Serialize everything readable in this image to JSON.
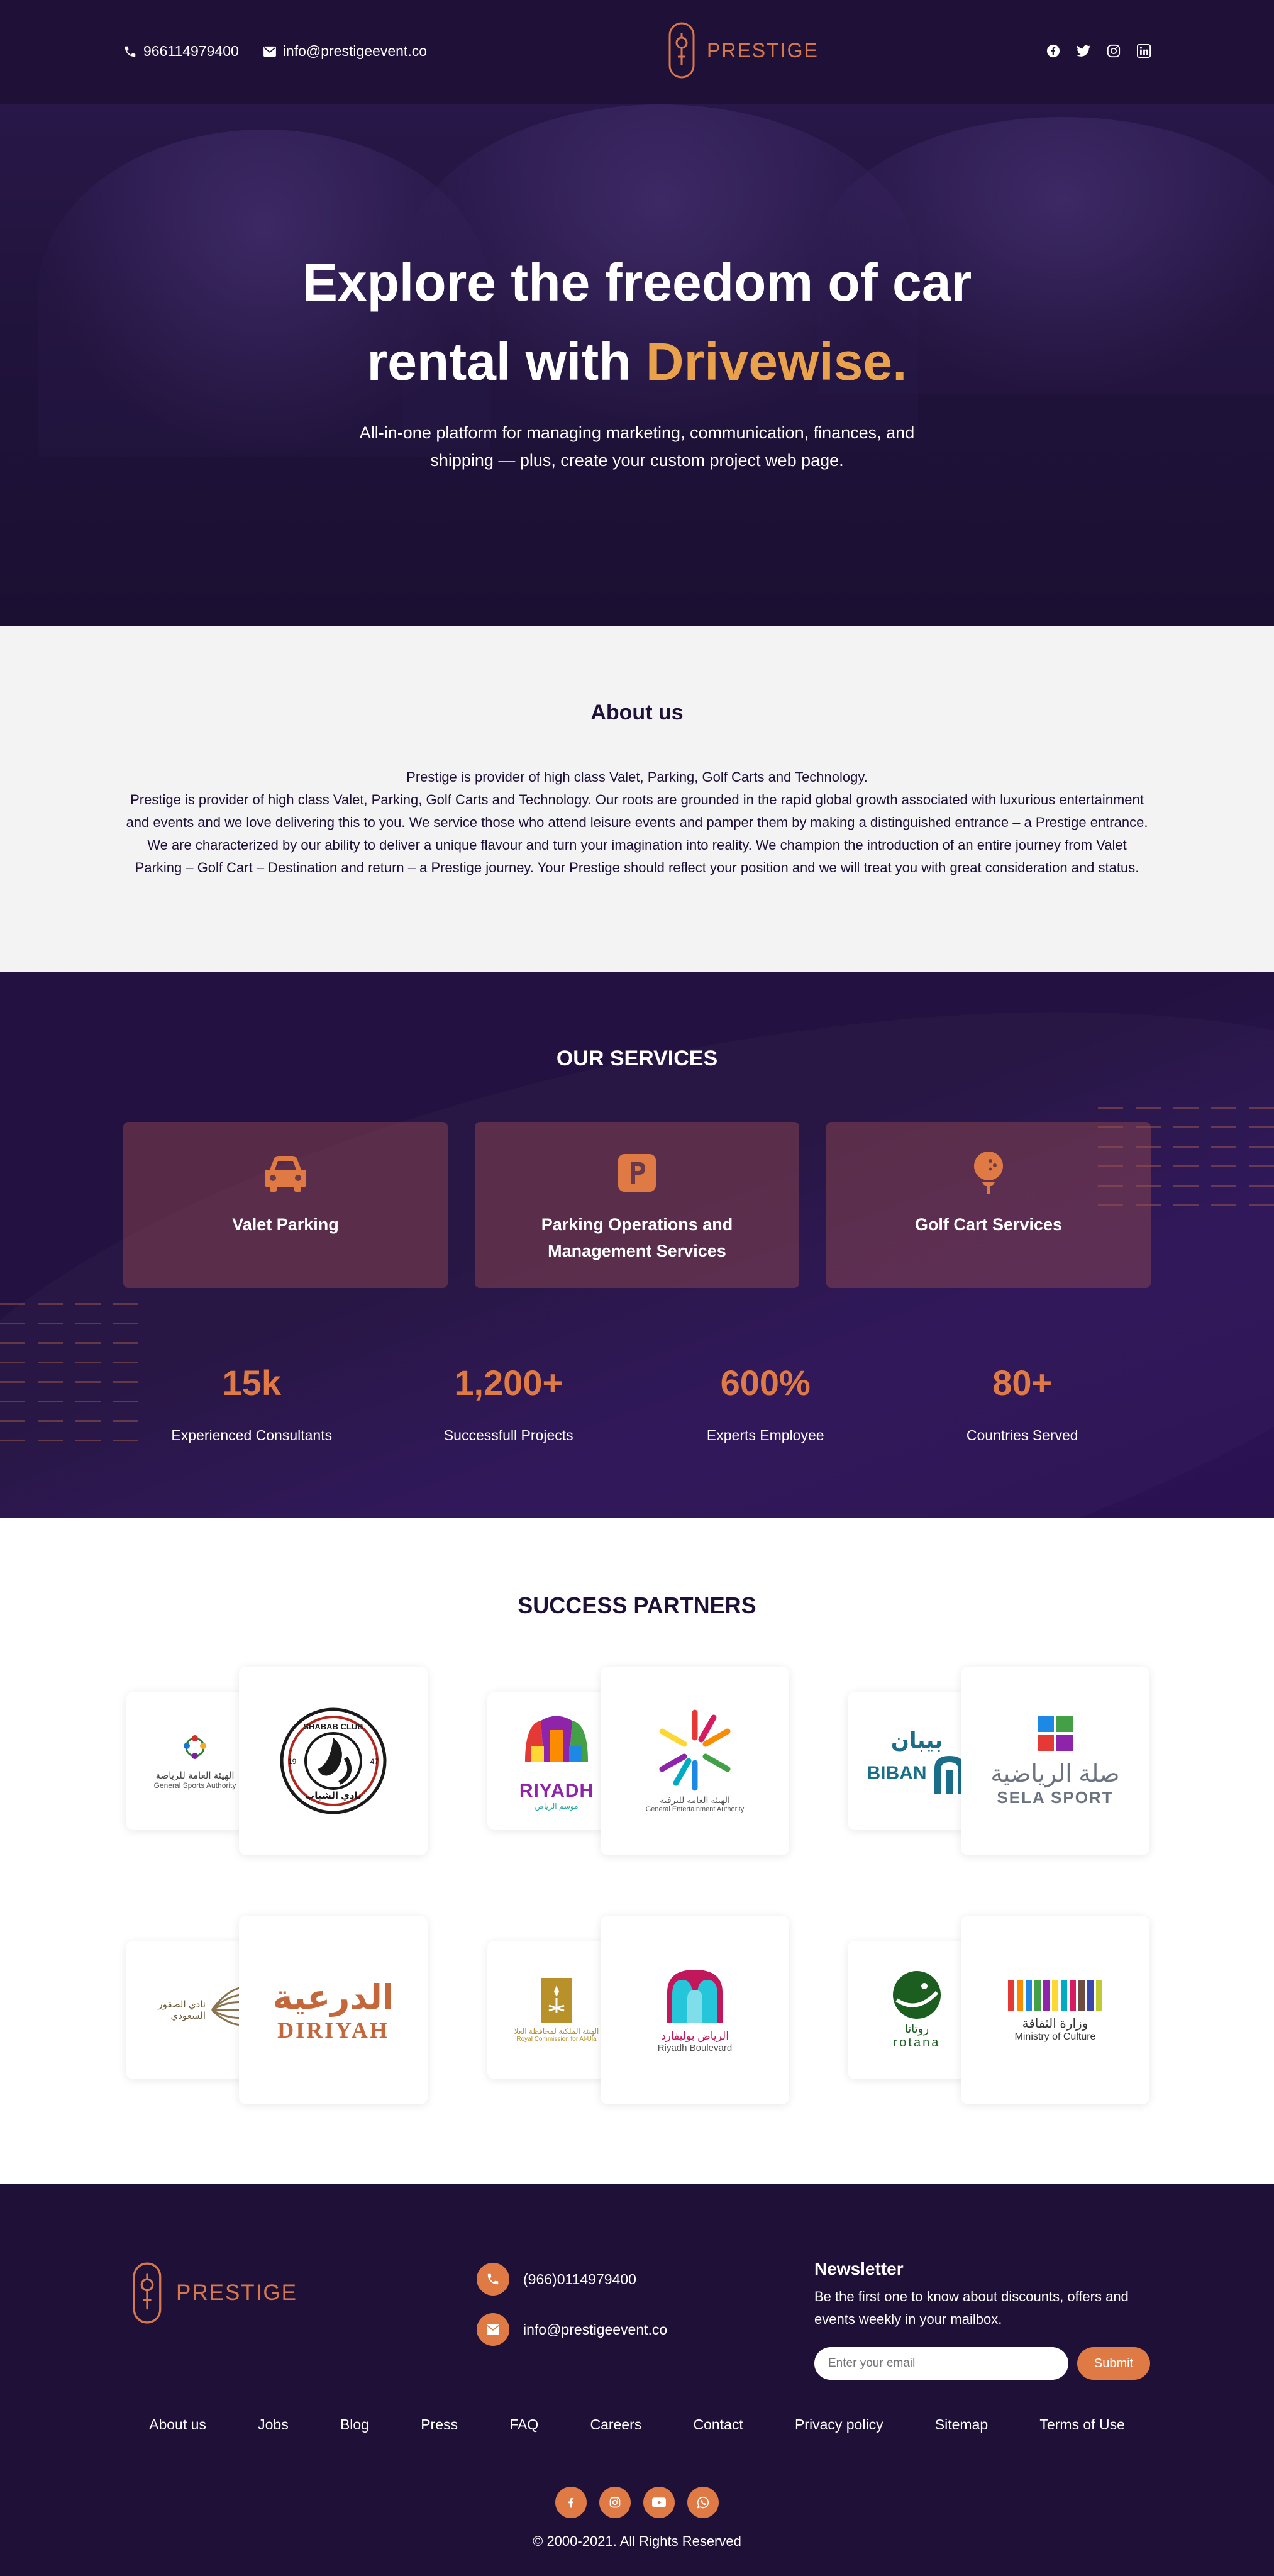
{
  "header": {
    "phone": "966114979400",
    "email": "info@prestigeevent.co",
    "brand": "PRESTIGE",
    "social": [
      "facebook-icon",
      "twitter-icon",
      "instagram-icon",
      "linkedin-icon"
    ]
  },
  "hero": {
    "title_line1": "Explore the freedom of car",
    "title_line2_prefix": "rental with ",
    "title_highlight": "Drivewise.",
    "subtitle": "All-in-one platform for managing marketing, communication, finances, and shipping — plus, create your custom project web page."
  },
  "about": {
    "heading": "About us",
    "text": "Prestige is provider of high class Valet, Parking, Golf Carts and Technology.\nPrestige is provider of high class Valet, Parking, Golf Carts and Technology. Our roots are grounded in the rapid global growth associated with luxurious entertainment and events and we love delivering this to you.  We service those who attend leisure events and pamper them by making a distinguished entrance – a Prestige entrance. We are characterized by our ability to deliver a unique flavour and turn your imagination into reality.  We champion the introduction of an entire journey from Valet Parking – Golf Cart – Destination and return – a Prestige journey. Your Prestige should reflect your position and we will treat you with great consideration and status."
  },
  "services": {
    "heading": "OUR SERVICES",
    "items": [
      {
        "label": "Valet Parking",
        "icon": "car-icon"
      },
      {
        "label": "Parking Operations and Management Services",
        "icon": "parking-icon"
      },
      {
        "label": "Golf Cart Services",
        "icon": "golf-icon"
      }
    ],
    "stats": [
      {
        "value": "15k",
        "label": "Experienced Consultants"
      },
      {
        "value": "1,200+",
        "label": "Successfull Projects"
      },
      {
        "value": "600%",
        "label": "Experts Employee"
      },
      {
        "value": "80+",
        "label": "Countries Served"
      }
    ]
  },
  "partners": {
    "heading": "SUCCESS PARTNERS",
    "logos": {
      "gsa_ar": "الهيئة العامة للرياضة",
      "gsa_en": "General Sports Authority",
      "shabab_top": "SHABAB CLUB",
      "shabab_ar": "نادي الشباب",
      "shabab_l": "19",
      "shabab_r": "47",
      "riyadh": "RIYADH",
      "riyadh_ar": "موسم الرياض",
      "gea_ar": "الهيئة العامة للترفيه",
      "gea_en": "General Entertainment Authority",
      "biban_ar": "بيبان",
      "biban_en": "BIBAN",
      "sela_ar": "صلة الرياضية",
      "sela_en": "SELA SPORT",
      "falcon_ar": "نادي الصقور السعودي",
      "diriyah_ar": "الدرعية",
      "diriyah_en": "DIRIYAH",
      "rcu_ar": "الهيئة الملكية لمحافظة العلا",
      "rcu_en": "Royal Commission for Al-Ula",
      "boulevard_ar": "الرياض بوليفارد",
      "boulevard_en": "Riyadh Boulevard",
      "rotana_ar": "روتانا",
      "rotana_en": "rotana",
      "moc_ar": "وزارة الثقافة",
      "moc_en": "Ministry of Culture"
    }
  },
  "footer": {
    "brand": "PRESTIGE",
    "phone": "(966)0114979400",
    "email": "info@prestigeevent.co",
    "newsletter_title": "Newsletter",
    "newsletter_text": "Be the first one to know about discounts, offers and events weekly in your mailbox.",
    "email_placeholder": "Enter your email",
    "submit_label": "Submit",
    "nav": [
      "About us",
      "Jobs",
      "Blog",
      "Press",
      "FAQ",
      "Careers",
      "Contact",
      "Privacy policy",
      "Sitemap",
      "Terms of Use"
    ],
    "social": [
      "facebook-icon",
      "instagram-icon",
      "youtube-icon",
      "whatsapp-icon"
    ],
    "copyright": "© 2000-2021. All Rights Reserved"
  },
  "colors": {
    "primary_dark": "#1f1038",
    "accent": "#e07a45",
    "highlight": "#e9a14b",
    "light_bg": "#f3f3f3"
  }
}
